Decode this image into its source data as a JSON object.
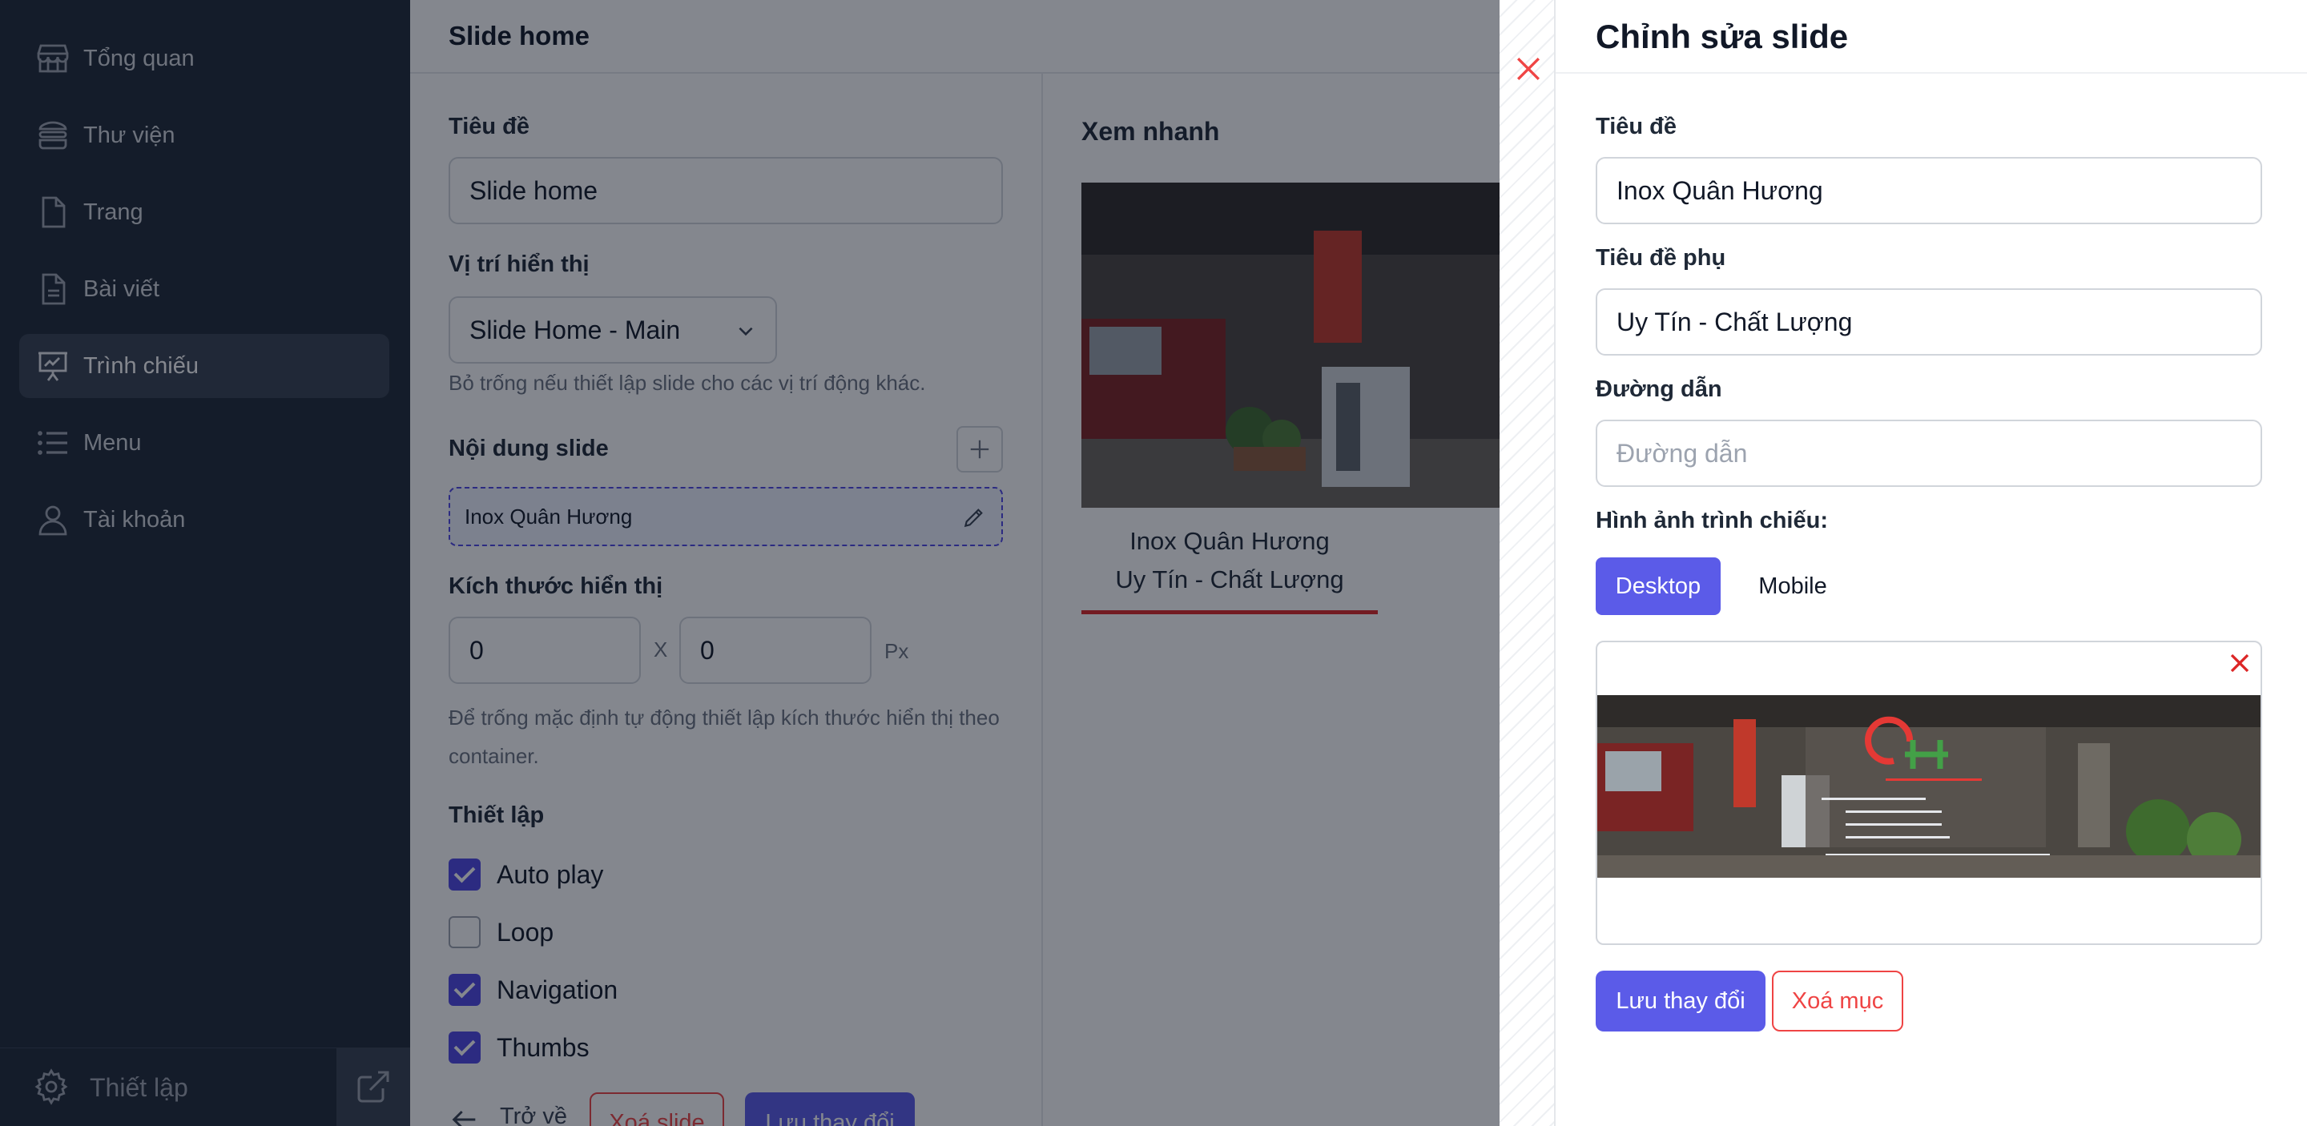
{
  "sidebar": {
    "items": [
      {
        "label": "Tổng quan",
        "icon": "store-icon"
      },
      {
        "label": "Thư viện",
        "icon": "stack-icon"
      },
      {
        "label": "Trang",
        "icon": "page-icon"
      },
      {
        "label": "Bài viết",
        "icon": "article-icon"
      },
      {
        "label": "Trình chiếu",
        "icon": "presentation-icon",
        "active": true
      },
      {
        "label": "Menu",
        "icon": "list-icon"
      },
      {
        "label": "Tài khoản",
        "icon": "user-icon"
      }
    ],
    "settings_label": "Thiết lập"
  },
  "main": {
    "title": "Slide home",
    "title_label": "Tiêu đề",
    "title_value": "Slide home",
    "position_label": "Vị trí hiển thị",
    "position_value": "Slide Home - Main",
    "position_help": "Bỏ trống nếu thiết lập slide cho các vị trí động khác.",
    "content_label": "Nội dung slide",
    "content_item": "Inox Quân Hương",
    "size_label": "Kích thước hiển thị",
    "width_value": "0",
    "height_value": "0",
    "size_sep": "X",
    "size_unit": "Px",
    "size_help": "Để trống mặc định tự động thiết lập kích thước hiển thị theo container.",
    "settings_label": "Thiết lập",
    "options": [
      {
        "label": "Auto play",
        "checked": true
      },
      {
        "label": "Loop",
        "checked": false
      },
      {
        "label": "Navigation",
        "checked": true
      },
      {
        "label": "Thumbs",
        "checked": true
      }
    ],
    "back_label": "Trở về",
    "delete_label": "Xoá slide",
    "save_label": "Lưu thay đổi",
    "preview_label": "Xem nhanh",
    "preview_caption_1": "Inox Quân Hương",
    "preview_caption_2": "Uy Tín - Chất Lượng"
  },
  "drawer": {
    "heading": "Chỉnh sửa slide",
    "title_label": "Tiêu đề",
    "title_value": "Inox Quân Hương",
    "subtitle_label": "Tiêu đề phụ",
    "subtitle_value": "Uy Tín - Chất Lượng",
    "link_label": "Đường dẫn",
    "link_placeholder": "Đường dẫn",
    "image_label": "Hình ảnh trình chiếu:",
    "tab_desktop": "Desktop",
    "tab_mobile": "Mobile",
    "save_label": "Lưu thay đổi",
    "delete_label": "Xoá mục"
  },
  "colors": {
    "sidebar_bg": "#1f2937",
    "accent": "#5b5be8",
    "danger": "#ef4444"
  }
}
